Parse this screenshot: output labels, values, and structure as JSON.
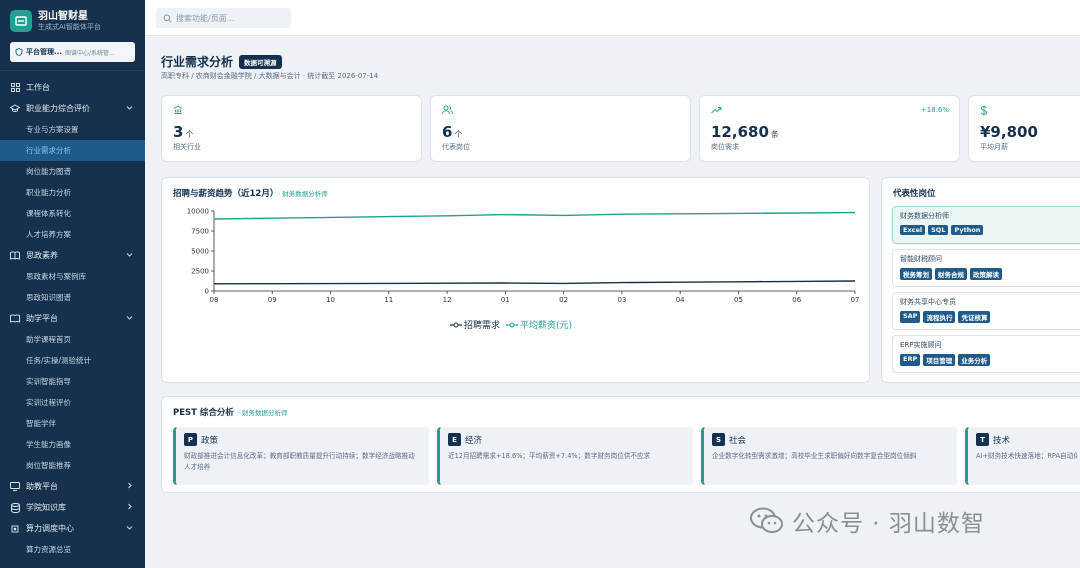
{
  "brand": {
    "title": "羽山智财星",
    "subtitle": "生成式AI智能体平台"
  },
  "platform": {
    "label": "平台管理...",
    "sub": "图谱中心/系统管..."
  },
  "nav": {
    "workbench": "工作台",
    "career": {
      "label": "职业能力综合评价",
      "items": [
        "专业与方案设置",
        "行业需求分析",
        "岗位能力图谱",
        "职业能力分析",
        "课程体系转化",
        "人才培养方案"
      ]
    },
    "ideology": {
      "label": "思政素养",
      "items": [
        "思政素材与案例库",
        "思政知识图谱"
      ]
    },
    "learning": {
      "label": "助学平台",
      "items": [
        "助学课程首页",
        "任务/实操/测验统计",
        "实训智能指导",
        "实训过程评价",
        "智能学伴",
        "学生能力画像",
        "岗位智能推荐"
      ]
    },
    "teaching": "助教平台",
    "knowledge": "学院知识库",
    "compute": {
      "label": "算力调度中心",
      "items": [
        "算力资源总览"
      ]
    }
  },
  "search": {
    "placeholder": "搜索功能/页面..."
  },
  "page": {
    "title": "行业需求分析",
    "badge": "数据可溯源",
    "breadcrumb": "高职专科 / 农商财会金融学院 / 大数据与会计 · 统计截至 2026-07-14"
  },
  "kpis": [
    {
      "value": "3",
      "unit": "个",
      "label": "相关行业",
      "icon": "bank-icon"
    },
    {
      "value": "6",
      "unit": "个",
      "label": "代表岗位",
      "icon": "users-icon"
    },
    {
      "value": "12,680",
      "unit": "条",
      "label": "岗位需求",
      "icon": "trend-up-icon",
      "trend": "+18.6%"
    },
    {
      "value": "¥9,800",
      "unit": "",
      "label": "平均月薪",
      "icon": "dollar-icon"
    }
  ],
  "trend": {
    "title": "招聘与薪资趋势（近12月）",
    "tag": "· 财务数据分析师"
  },
  "chart_data": {
    "type": "line",
    "x": [
      "08",
      "09",
      "10",
      "11",
      "12",
      "01",
      "02",
      "03",
      "04",
      "05",
      "06",
      "07"
    ],
    "series": [
      {
        "name": "招聘需求",
        "values": [
          900,
          920,
          930,
          950,
          980,
          1000,
          950,
          1050,
          1100,
          1150,
          1200,
          1250
        ],
        "color": "#15314d"
      },
      {
        "name": "平均薪资(元)",
        "values": [
          9000,
          9100,
          9200,
          9300,
          9400,
          9550,
          9450,
          9600,
          9650,
          9700,
          9750,
          9800
        ],
        "color": "#1fa291"
      }
    ],
    "yticks": [
      0,
      2500,
      5000,
      7500,
      10000
    ],
    "ylim": [
      0,
      10000
    ],
    "legend": "bottom-center"
  },
  "roles": {
    "title": "代表性岗位",
    "items": [
      {
        "name": "财务数据分析师",
        "skills": [
          "Excel",
          "SQL",
          "Python"
        ]
      },
      {
        "name": "智能财税顾问",
        "skills": [
          "税务筹划",
          "财务合规",
          "政策解读"
        ]
      },
      {
        "name": "财务共享中心专员",
        "skills": [
          "SAP",
          "流程执行",
          "凭证核算"
        ]
      },
      {
        "name": "ERP实施顾问",
        "skills": [
          "ERP",
          "项目管理",
          "业务分析"
        ]
      }
    ]
  },
  "pest": {
    "title": "PEST 综合分析",
    "tag": "· 财务数据分析师",
    "items": [
      {
        "letter": "P",
        "name": "政策",
        "text": "财政部推进会计信息化改革；教育部职教质量提升行动持续；数字经济战略推动人才培养"
      },
      {
        "letter": "E",
        "name": "经济",
        "text": "近12月招聘需求+18.6%；平均薪资+7.4%；数字财务岗位供不应求"
      },
      {
        "letter": "S",
        "name": "社会",
        "text": "企业数字化转型需求激增；高校毕业生求职偏好向数字复合型岗位倾斜"
      },
      {
        "letter": "T",
        "name": "技术",
        "text": "AI+财务技术快速落地；RPA自动化核心技能"
      }
    ]
  },
  "watermark": "公众号 · 羽山数智"
}
